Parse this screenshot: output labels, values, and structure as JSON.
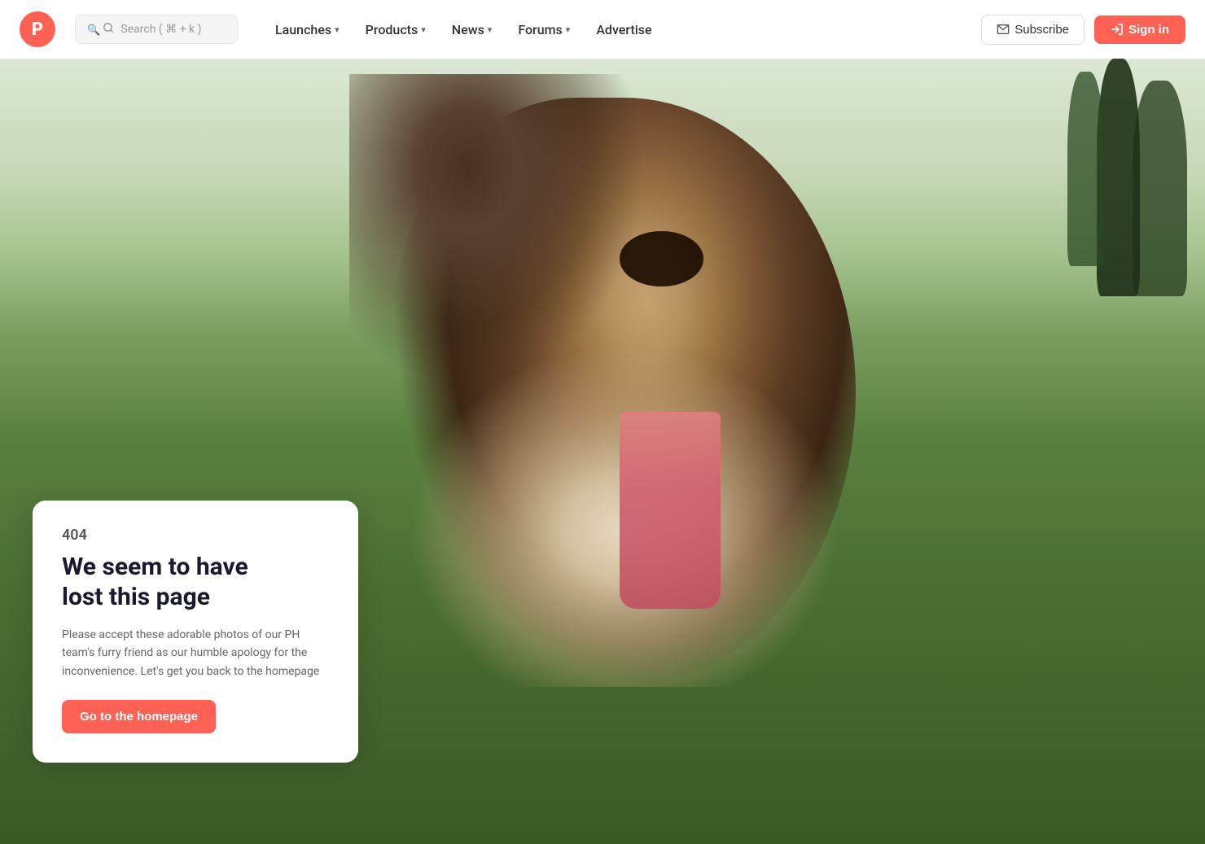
{
  "logo": {
    "letter": "P",
    "color": "#FF6154"
  },
  "search": {
    "placeholder": "Search ( ⌘ + k )"
  },
  "nav": {
    "items": [
      {
        "id": "launches",
        "label": "Launches",
        "hasDropdown": true
      },
      {
        "id": "products",
        "label": "Products",
        "hasDropdown": true
      },
      {
        "id": "news",
        "label": "News",
        "hasDropdown": true
      },
      {
        "id": "forums",
        "label": "Forums",
        "hasDropdown": true
      },
      {
        "id": "advertise",
        "label": "Advertise",
        "hasDropdown": false
      }
    ]
  },
  "auth": {
    "subscribe_label": "Subscribe",
    "signin_label": "Sign in"
  },
  "error_page": {
    "code": "404",
    "title_line1": "We seem to have",
    "title_line2": "lost this page",
    "description": "Please accept these adorable photos of our PH team's furry friend as our humble apology for the inconvenience. Let's get you back to the homepage",
    "cta_label": "Go to the homepage"
  }
}
